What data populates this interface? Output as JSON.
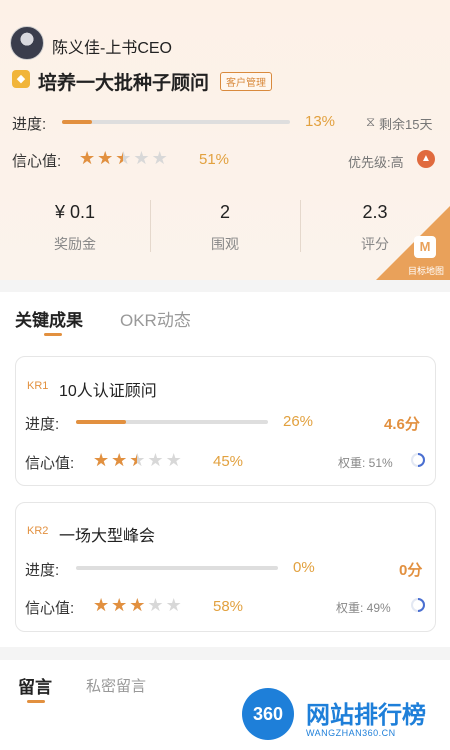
{
  "header": {
    "owner": "陈义佳-上书CEO",
    "objective_title": "培养一大批种子顾问",
    "objective_tag": "客户管理",
    "progress_label": "进度:",
    "progress_value": 0.13,
    "progress_text": "13%",
    "remaining": "剩余15天",
    "confidence_label": "信心值:",
    "confidence_stars": 2.5,
    "confidence_text": "51%",
    "priority": "优先级:高"
  },
  "stats": [
    {
      "value": "¥ 0.1",
      "label": "奖励金"
    },
    {
      "value": "2",
      "label": "围观"
    },
    {
      "value": "2.3",
      "label": "评分"
    }
  ],
  "map_label": "目标地图",
  "tabs": [
    {
      "label": "关键成果",
      "active": true
    },
    {
      "label": "OKR动态",
      "active": false
    }
  ],
  "krs": [
    {
      "tag": "KR1",
      "title": "10人认证顾问",
      "progress_label": "进度:",
      "progress_value": 0.26,
      "progress_text": "26%",
      "score": "4.6分",
      "confidence_label": "信心值:",
      "confidence_stars": 2.5,
      "confidence_text": "45%",
      "weight": "权重: 51%"
    },
    {
      "tag": "KR2",
      "title": "一场大型峰会",
      "progress_label": "进度:",
      "progress_value": 0,
      "progress_text": "0%",
      "score": "0分",
      "confidence_label": "信心值:",
      "confidence_stars": 3,
      "confidence_text": "58%",
      "weight": "权重: 49%"
    }
  ],
  "comment_tabs": [
    {
      "label": "留言",
      "active": true
    },
    {
      "label": "私密留言",
      "active": false
    }
  ],
  "watermark": {
    "logo": "360",
    "name": "网站排行榜",
    "sub": "WANGZHAN360.CN"
  },
  "colors": {
    "accent": "#e2903f",
    "header_bg": "#fdf1e7"
  }
}
